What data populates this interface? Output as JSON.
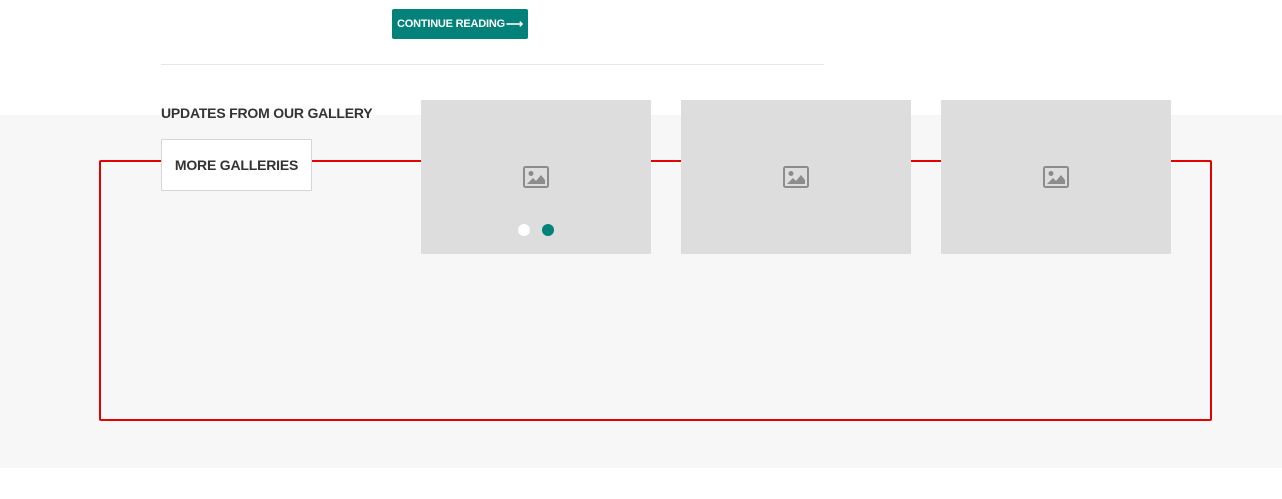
{
  "post": {
    "continue_label": "CONTINUE READING",
    "continue_arrow": "⟶"
  },
  "gallery": {
    "heading": "UPDATES FROM OUR GALLERY",
    "more_label": "MORE GALLERIES",
    "thumbnails": [
      {
        "icon": "image-placeholder-icon"
      },
      {
        "icon": "image-placeholder-icon"
      },
      {
        "icon": "image-placeholder-icon"
      }
    ],
    "carousel": {
      "total_pages": 2,
      "active_page": 2
    }
  },
  "colors": {
    "accent": "#00827a",
    "highlight_border": "#e30000",
    "band_background": "#f7f7f7",
    "thumbnail_placeholder": "#dddddd"
  }
}
